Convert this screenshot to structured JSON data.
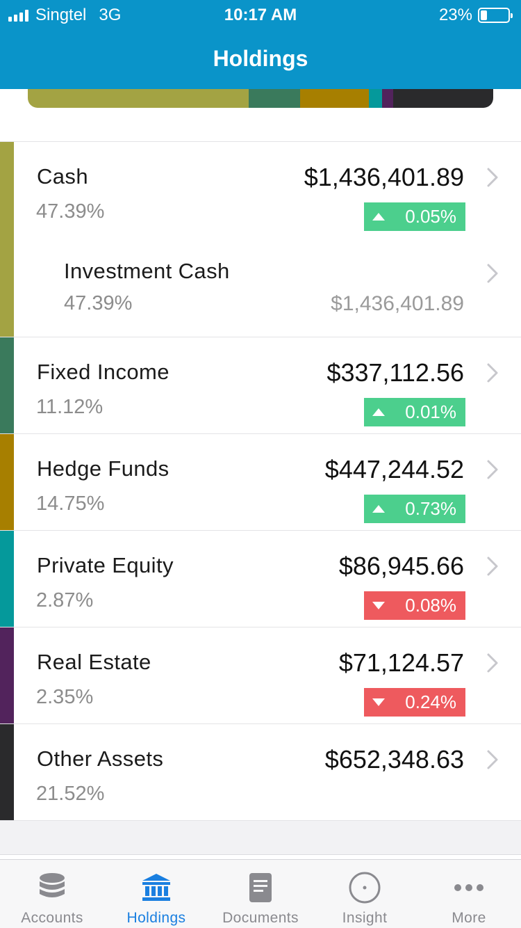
{
  "status_bar": {
    "carrier": "Singtel",
    "network": "3G",
    "time": "10:17 AM",
    "battery_percent": "23%",
    "battery_level": 0.23
  },
  "header": {
    "title": "Holdings"
  },
  "allocation_bar": {
    "segments": [
      {
        "name": "Cash",
        "share_percent": 47.39,
        "color": "#a3a343"
      },
      {
        "name": "Fixed Income",
        "share_percent": 11.12,
        "color": "#3a7a5c"
      },
      {
        "name": "Hedge Funds",
        "share_percent": 14.75,
        "color": "#a77f00"
      },
      {
        "name": "Private Equity",
        "share_percent": 2.87,
        "color": "#05999b"
      },
      {
        "name": "Real Estate",
        "share_percent": 2.35,
        "color": "#52235c"
      },
      {
        "name": "Other Assets",
        "share_percent": 21.52,
        "color": "#2a2a2c"
      }
    ]
  },
  "holdings": [
    {
      "name": "Cash",
      "percent": "47.39%",
      "value": "$1,436,401.89",
      "change": "0.05%",
      "direction": "up",
      "color": "#a3a343"
    },
    {
      "name": "Investment Cash",
      "percent": "47.39%",
      "value": "$1,436,401.89",
      "sub": true,
      "color": "#a3a343"
    },
    {
      "name": "Fixed Income",
      "percent": "11.12%",
      "value": "$337,112.56",
      "change": "0.01%",
      "direction": "up",
      "color": "#3a7a5c"
    },
    {
      "name": "Hedge Funds",
      "percent": "14.75%",
      "value": "$447,244.52",
      "change": "0.73%",
      "direction": "up",
      "color": "#a77f00"
    },
    {
      "name": "Private Equity",
      "percent": "2.87%",
      "value": "$86,945.66",
      "change": "0.08%",
      "direction": "down",
      "color": "#05999b"
    },
    {
      "name": "Real Estate",
      "percent": "2.35%",
      "value": "$71,124.57",
      "change": "0.24%",
      "direction": "down",
      "color": "#52235c"
    },
    {
      "name": "Other Assets",
      "percent": "21.52%",
      "value": "$652,348.63",
      "color": "#2a2a2c"
    }
  ],
  "colors": {
    "header_bg": "#0a94c9",
    "up": "#4ccf8d",
    "down": "#ee5a5e",
    "tab_active": "#1a7fe0",
    "tab_inactive": "#8a8a8f"
  },
  "tabs": [
    {
      "label": "Accounts",
      "icon": "database-icon",
      "active": false
    },
    {
      "label": "Holdings",
      "icon": "bank-icon",
      "active": true
    },
    {
      "label": "Documents",
      "icon": "document-icon",
      "active": false
    },
    {
      "label": "Insight",
      "icon": "compass-icon",
      "active": false
    },
    {
      "label": "More",
      "icon": "more-dots-icon",
      "active": false
    }
  ]
}
